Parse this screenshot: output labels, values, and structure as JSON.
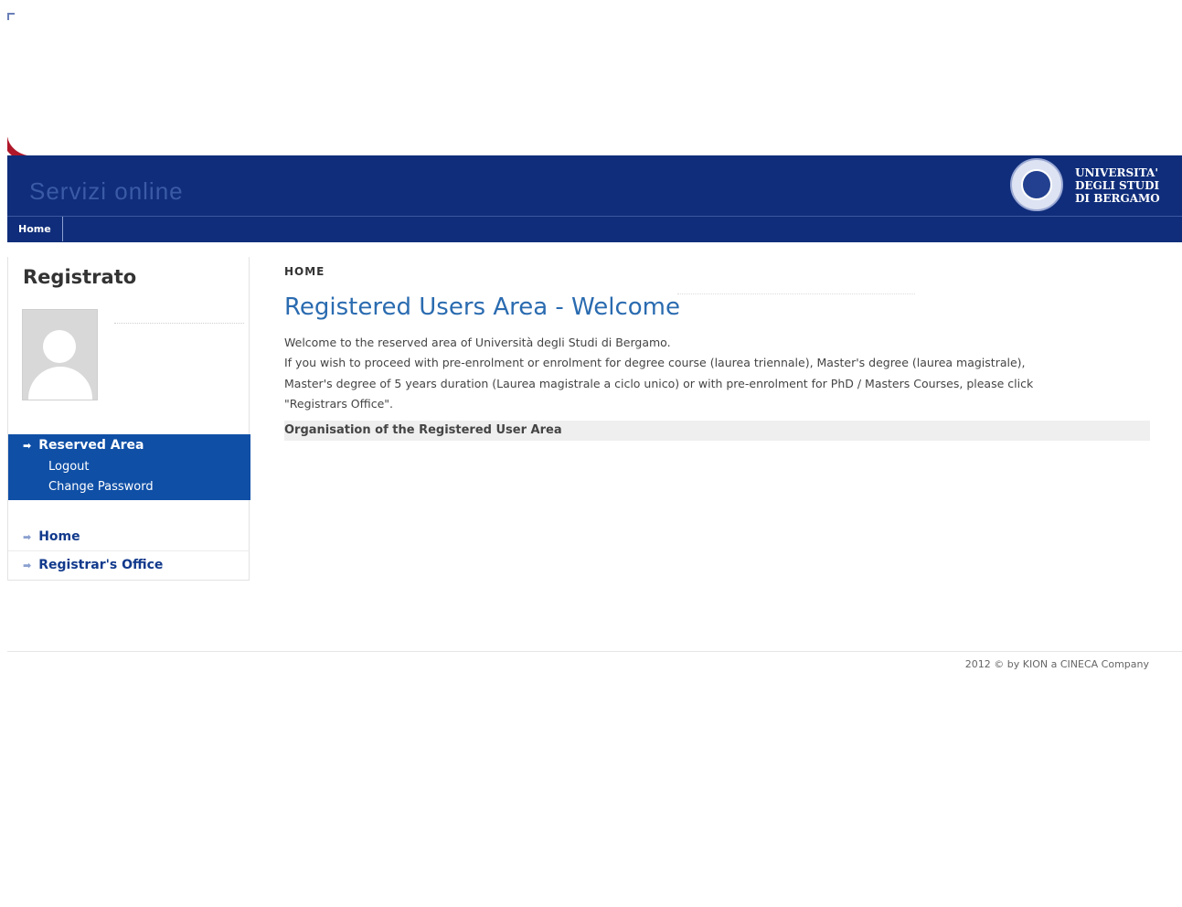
{
  "header": {
    "site_title": "Servizi online",
    "university_lines": [
      "UNIVERSITA'",
      "DEGLI STUDI",
      "DI BERGAMO"
    ]
  },
  "nav": {
    "items": [
      {
        "label": "Home"
      }
    ]
  },
  "sidebar": {
    "user_title": "Registrato",
    "reserved_area": {
      "header": "Reserved Area",
      "links": [
        {
          "label": "Logout"
        },
        {
          "label": "Change Password"
        }
      ]
    },
    "menu": [
      {
        "label": "Home"
      },
      {
        "label": "Registrar's Office"
      }
    ]
  },
  "main": {
    "breadcrumb": "HOME",
    "title": "Registered Users Area - Welcome",
    "welcome_text": "Welcome to the reserved area of Università degli Studi di Bergamo.",
    "info_line1": "If you wish to proceed with pre-enrolment or enrolment for degree course (laurea triennale), Master's degree (laurea magistrale),",
    "info_line2": "Master's degree of 5 years duration (Laurea magistrale a ciclo unico) or with pre-enrolment for PhD / Masters Courses, please click",
    "info_line3": "\"Registrars Office\".",
    "section_title": "Organisation of the Registered User Area"
  },
  "footer": {
    "text": "2012 © by KION a CINECA Company"
  },
  "colors": {
    "header_bg": "#0f2d7a",
    "reserved_bg": "#0f4fa6",
    "title": "#2a6bb0",
    "accent_red": "#b0182a"
  }
}
